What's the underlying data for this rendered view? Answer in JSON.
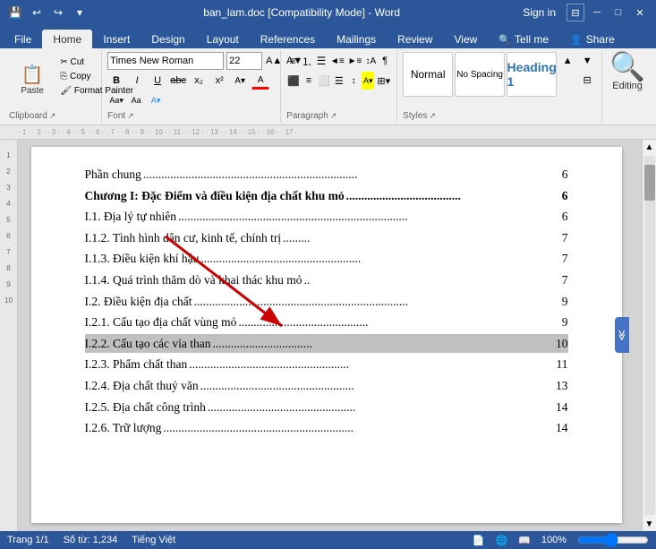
{
  "titlebar": {
    "title": "ban_lam.doc [Compatibility Mode] - Word",
    "sign_in": "Sign in",
    "buttons": [
      "─",
      "□",
      "✕"
    ]
  },
  "quick_access": [
    "💾",
    "↩",
    "↪",
    "▾"
  ],
  "ribbon_tabs": [
    "File",
    "Home",
    "Insert",
    "Design",
    "Layout",
    "References",
    "Mailings",
    "Review",
    "View",
    "Tell me",
    "Share"
  ],
  "active_tab": "Home",
  "ribbon": {
    "clipboard_label": "Clipboard",
    "font_label": "Font",
    "paragraph_label": "Paragraph",
    "styles_label": "Styles",
    "editing_label": "Editing",
    "font_name": "Times New Roman",
    "font_size": "22",
    "paste_label": "Paste",
    "bold": "B",
    "italic": "I",
    "underline": "U"
  },
  "document": {
    "toc": [
      {
        "text": "Phần chung",
        "dots": ".......................................................................",
        "page": "6",
        "bold": false,
        "highlighted": false
      },
      {
        "text": "Chương I: Đặc Điểm và điều kiện địa chất khu mỏ",
        "dots": "......................................",
        "page": "6",
        "bold": true,
        "highlighted": false
      },
      {
        "text": "I.1. Địa lý tự  nhiên",
        "dots": "............................................................................",
        "page": "6",
        "bold": false,
        "highlighted": false
      },
      {
        "text": "   I.1.2.    Tình hình dân cư, kinh tế, chính trị",
        "dots": ".........",
        "page": "7",
        "bold": false,
        "highlighted": false
      },
      {
        "text": "   I.1.3. Điều kiện khí hậu",
        "dots": ".....................................................",
        "page": "7",
        "bold": false,
        "highlighted": false
      },
      {
        "text": "   I.1.4. Quá trình thăm dò và khai thác khu mỏ",
        "dots": "..",
        "page": "7",
        "bold": false,
        "highlighted": false
      },
      {
        "text": "I.2. Điều kiện địa chất",
        "dots": ".......................................................................",
        "page": "9",
        "bold": false,
        "highlighted": false
      },
      {
        "text": "   I.2.1. Cấu tạo địa chất vùng mỏ",
        "dots": "...........................................",
        "page": "9",
        "bold": false,
        "highlighted": false
      },
      {
        "text": "   I.2.2. Cấu tạo các vỉa than",
        "dots": ".................................",
        "page": "10",
        "bold": false,
        "highlighted": true
      },
      {
        "text": "   I.2.3. Phẩm chất than",
        "dots": ".....................................................",
        "page": "11",
        "bold": false,
        "highlighted": false
      },
      {
        "text": "   I.2.4. Địa chất thuỷ văn",
        "dots": "...................................................",
        "page": "13",
        "bold": false,
        "highlighted": false
      },
      {
        "text": "   I.2.5. Địa chất công trình",
        "dots": ".................................................",
        "page": "14",
        "bold": false,
        "highlighted": false
      },
      {
        "text": "   I.2.6. Trữ lượng",
        "dots": "...............................................................",
        "page": "14",
        "bold": false,
        "highlighted": false
      }
    ]
  },
  "statusbar": {
    "page": "Trang 1/1",
    "words": "Số từ: 1,234",
    "language": "Tiếng Việt"
  },
  "colors": {
    "ribbon_bg": "#2b579a",
    "active_tab_bg": "#f0f0f0",
    "highlight": "#c0c0c0",
    "arrow_red": "#cc0000"
  }
}
